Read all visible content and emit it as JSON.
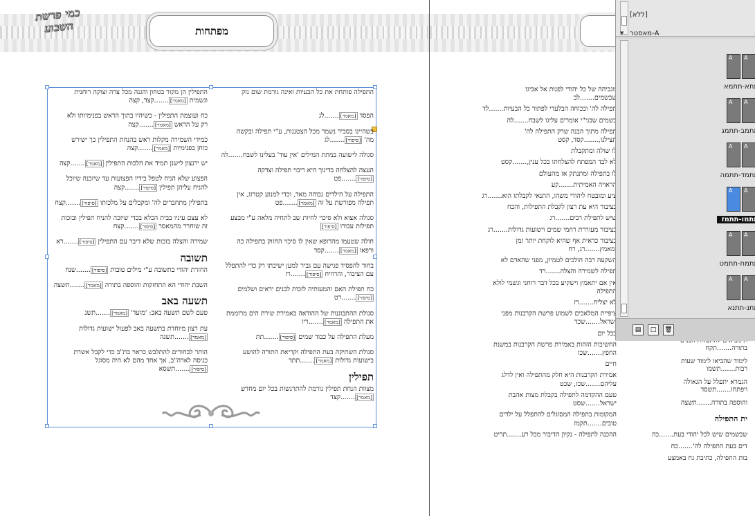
{
  "left_page": {
    "title": "מפתחות",
    "logo_text": "כמי פרשת השבוע",
    "right_column": [
      {
        "text": "התפילה פותחת את כל הבעיות ואינה גורמת שום נזק",
        "tag": "",
        "tail": ""
      },
      {
        "text": "",
        "tag": "[מאמר]",
        "tail": "לג",
        "lead": "הפסד"
      },
      {
        "text": "בשהיינו בסביר נשמר מכל הצטננות, ע\"י תפילה ובקשה",
        "tag": "[סיפור]",
        "tail": "לג",
        "lead": "מה'"
      },
      {
        "text": "סגולה לישועה במתת המילים 'אין עוד' בעלינו לשבח",
        "tag": "",
        "tail": "לה",
        "lead": ""
      },
      {
        "text": "העצה להצלחה בדינוך היא ריבוי תפילה וצדקה",
        "tag": "[סיפור]",
        "tail": "פט",
        "lead": ""
      },
      {
        "text": "התפילה על הילדים גבוהה מאד, וכדי למנוע קטרוג, אין",
        "tag": "[מאמר]",
        "tail": "פט",
        "lead": "תפילה מפורשת על זה"
      },
      {
        "text": "סגולה אצוא ולא סיכוי לחיות שב לתחיה מלאה ע\"י מבצע",
        "tag": "[סיפור]",
        "tail": "",
        "lead": "תפילות עבורו"
      },
      {
        "text": "חולה שטעמו מהרופא שאין לו סיכוי החזוק בתפילה כה",
        "tag": "[מאמר]",
        "tail": "קסד",
        "lead": "ורפאו"
      },
      {
        "text": "בחור להפסיד פגישה עם גביר למען ישיבתו רק כדי להתפלל",
        "tag": "[סיפור]",
        "tail": "רז",
        "lead": "עם הציבור, והרוויח"
      },
      {
        "text": "כח תפילת האם והמעותיה לזכות לבנים יראים ושלמים",
        "tag": "[סיפור]",
        "tail": "רט",
        "lead": ""
      },
      {
        "text": "סגולת ההתבוננות של ההודאה באמירת שירת הים מרוממת",
        "tag": "[מאמר]",
        "tail": "ריז",
        "lead": "את התפילה"
      },
      {
        "text": "מעלת התפילה על כבוד שמים",
        "tag": "[סיפור]",
        "tail": "תת",
        "lead": ""
      },
      {
        "text": "סגולת השתיקה בעת התפילה וקריאת התורה להושע",
        "tag": "[מאמר]",
        "tail": "תתד",
        "lead": "בישועות גדולות"
      }
    ],
    "right_heading": "תפילין",
    "right_after": [
      {
        "text": "מצוות הנחת תפילין גורמת להתרגשות בכל יום מחדש",
        "tag": "[מאמר]",
        "tail": "קצד",
        "lead": ""
      }
    ],
    "left_column": [
      {
        "text": "התפילין הן מקור בטחון והגנה מכל צרה וצוקה רוחנית",
        "tag": "[מאמר]",
        "tail": "קצד, קצה",
        "lead": "וגשמית"
      },
      {
        "text": "כח ועוצמת התפילין - כשיהיו בתוך הראש בפנימיותו ולא",
        "tag": "[מאמר]",
        "tail": "קצה",
        "lead": "רק על הראש"
      },
      {
        "text": "כמידי השמירה מקלות ראש בהנחת התפילין כך ישירש",
        "tag": "[מאמר]",
        "tail": "קצה",
        "lead": "כוחן בפנימיות"
      },
      {
        "text": "יש ירנצון לישנן תמיד את הלכות התפילין",
        "tag": "[מאמר]",
        "tail": "קצה",
        "lead": ""
      },
      {
        "text": "הפצוע שלא הניח לטפל בידיו הפצועות עד שיזכנה שיוכל",
        "tag": "[סיפור]",
        "tail": "קצה",
        "lead": "להניח עליהן תפילין"
      },
      {
        "text": "בתפילין מתחברים לה' ומקבלים על מלכותו",
        "tag": "[סיפור]",
        "tail": "קצח",
        "lead": ""
      },
      {
        "text": "לא עצם עיניו בבית הכלא בכדי שיזכה להניח תפילין ובזכות",
        "tag": "[סיפור]",
        "tail": "קצח",
        "lead": "זה שוחרר מהמאסר"
      },
      {
        "text": "שמירה והצלה בזכות שלא דיבר עם התפילין",
        "tag": "[סיפור]",
        "tail": "רא",
        "lead": ""
      }
    ],
    "heading_teshuva": "תשובה",
    "teshuva": [
      {
        "text": "החזרת יהודי בתשובה ע\"י מילים טובות",
        "tag": "[סיפור]",
        "tail": "שנח",
        "lead": ""
      },
      {
        "text": "השבת יהודי הא התחזקות והוספה בתורה",
        "tag": "[מאמר]",
        "tail": "תשצה",
        "lead": ""
      }
    ],
    "heading_tisha": "תשעה באב",
    "tisha": [
      {
        "text": "טעם לשם תשעה באב: 'מועד'",
        "tag": "[מאמר]",
        "tail": "תשנ",
        "lead": ""
      },
      {
        "text": "עת רצון מיוחדת בתשעה באב לפעול ישועות גדולות",
        "tag": "[מאמר]",
        "tail": "תשנה",
        "lead": ""
      },
      {
        "text": "הותר לבחורים להתלבש כראוי בת\"ב כדי לקבל אשרת",
        "tag": "[סיפור]",
        "tail": "תשסא",
        "lead": "כניסה לארה\"ב, אך אחד מהם לא היה מסוגל"
      }
    ]
  },
  "right_page": {
    "entries": [
      {
        "text": "מגביהה של כל יהודי לפנות אל אביגו שבשמים",
        "tail": "לב"
      },
      {
        "text": "תפילה לה' ובכוחה הבלעדי לפתור כל הבעיות",
        "tail": "לד"
      },
      {
        "text": "בשמים שבגי\"י אומרים עליגו לשבח",
        "tail": "לה"
      },
      {
        "text": "תפילה מתוך הבנה שרק התפילה לה' תצילנו,",
        "tail": "קסד, קסט"
      },
      {
        "text": "לו שולה ומתקבלת",
        "tail": ""
      },
      {
        "text": "לא לבד המפתח להצלחתו בכל ענין,",
        "tail": "קסט"
      },
      {
        "text": "לו בתפילה ומתנתק אז מהעולם",
        "tail": ""
      },
      {
        "text": "הראויה האמיתית",
        "tail": "קע"
      },
      {
        "text": "ציע ומובטח ליהודי משהו, התנאי לקבלתו הוא",
        "tail": "רג"
      },
      {
        "text": "בציבור היא עת רצון לקבלת התפילות, והכח",
        "tail": ""
      },
      {
        "text": "שיש לתפילת רבים",
        "tail": "רג"
      },
      {
        "text": "בציבור מעוררת רחמי שמים וישועות גדולות",
        "tail": "רג"
      },
      {
        "text": "בציבור כדאית אף שהיא לוקחת יותר זמן ומאמץ",
        "tail": "רג, רח"
      },
      {
        "text": "השקעה רבה הולכים לטמיון, מפני שהאדם לא",
        "tail": ""
      },
      {
        "text": "תפילה לשמירה והצלה",
        "tail": "רד"
      },
      {
        "text": "אין אם יתאמץ וישקיע בכל דבר רוחני וגשמי לולא התפילה",
        "tail": ""
      },
      {
        "text": "לא יצליח",
        "tail": "רז"
      },
      {
        "text": "ציפיית המלאכים לשמוע פרשת הקרבנות מפני ישראל",
        "tail": "שכד"
      },
      {
        "text": "בכל יום",
        "tail": ""
      },
      {
        "text": "החשיבות הזהות באמירת פרשת הקרבנות במשנת החפץ",
        "tail": "שכו"
      },
      {
        "text": "חיים",
        "tail": ""
      },
      {
        "text": "אמירת הקרבנות היא חלק מהתפילה ואין לדלג עליהם",
        "tail": "שכז, שכט"
      },
      {
        "text": "טעם ההקדמה לתפילה בקבלת מצות אהבת ישראל",
        "tail": "שסט"
      },
      {
        "text": "המקומות בתפילה המסוגלים להתפלל על ילדים טובים",
        "tail": "תקמז"
      },
      {
        "text": "ההכנה לתפילה - נקיון הדיבור מכל רע",
        "tail": "תריט"
      }
    ],
    "lower": [
      {
        "text": "ת מביאים להתעלות הבנים בתורה",
        "tail": "תקח"
      },
      {
        "text": "לימוד שהביאו לימוד שעות רבות",
        "tail": "תשמו"
      },
      {
        "text": "הגמרא יתפלל על הגאולה ויפתחו",
        "tail": "תשסד"
      },
      {
        "text": "והוספה בתורה",
        "tail": "תשצה"
      }
    ],
    "lower_heading": "ית התפילה",
    "lower_after": [
      {
        "text": "שבשמים שיש לכל יהודי בעת",
        "tail": "כה"
      },
      {
        "text": "דים בעת התפילה לה'",
        "tail": "כח"
      },
      {
        "text": "בות התפילה, כתיבת גח באמצע",
        "tail": ""
      }
    ]
  },
  "pages_panel": {
    "masters": [
      "[ללא]",
      "A-מאסטר"
    ],
    "spreads": [
      {
        "label": "תתא-תתמא",
        "selected": false
      },
      {
        "label": "תתמב-תתמג",
        "selected": false
      },
      {
        "label": "תתמד-תתמה",
        "selected": false
      },
      {
        "label": "תתמו-תתמז",
        "selected": true
      },
      {
        "label": "תתמח-תתמט",
        "selected": false
      },
      {
        "label": "תתנ-תתנא",
        "selected": false
      }
    ],
    "page_letter": "A"
  }
}
